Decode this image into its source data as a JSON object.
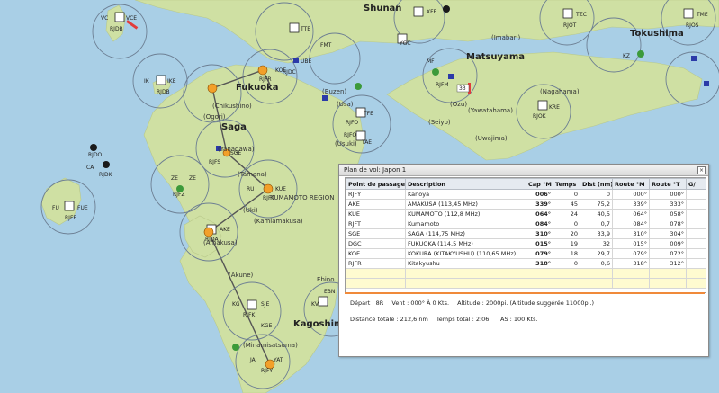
{
  "map": {
    "sea_color": "#a9cfe6",
    "land_color": "#cfe0a3",
    "route_color": "#555555",
    "labels": {
      "shikoku": "Matsuyama",
      "shunan": "Shunan",
      "kagoshima": "Kagoshima",
      "fukuoka": "Fukuoka",
      "saga": "Saga",
      "amakusa": "(Amakusa)",
      "kumamoto_region": "KUMAMOTO REGION",
      "tokushima": "Tokushima",
      "akune": "(Akune)",
      "imabari": "(Imabari)",
      "nagahama": "(Nagahama)",
      "yawatahama": "(Yawatahama)",
      "uwajima": "(Uwajima)",
      "seiyo": "(Seiyo)",
      "usuki": "(Usuki)",
      "yanagawa": "(Yanagawa)",
      "tamana": "(Tamana)",
      "uki": "(Uki)",
      "kamiamakusa": "(Kamiamakusa)",
      "minamisatsuma": "(Minamisatsuma)",
      "chikushino": "(Chikushino)",
      "ogori": "(Ogori)",
      "buzen": "(Buzen)",
      "usa": "(Usa)",
      "ebino": "Ebino",
      "yawatahama2": "(Ozu)",
      "badge": "33"
    },
    "stations": [
      {
        "code": "VCE",
        "sub": "RJDB",
        "extra": "VC"
      },
      {
        "code": "IKE",
        "sub": "RJDB",
        "extra": "IK"
      },
      {
        "code": "FUE",
        "sub": "RJFE",
        "extra": "FU"
      },
      {
        "code": "RJDK",
        "sub": "",
        "extra": "CA"
      },
      {
        "code": "RJDO",
        "sub": "",
        "extra": ""
      },
      {
        "code": "AKE",
        "sub": "RJDA",
        "extra": ""
      },
      {
        "code": "KUE",
        "sub": "RJFT",
        "extra": "RU"
      },
      {
        "code": "TAE",
        "sub": "RJFO",
        "extra": ""
      },
      {
        "code": "TFE",
        "sub": "RJFO",
        "extra": ""
      },
      {
        "code": "KOE",
        "sub": "RJFR",
        "extra": ""
      },
      {
        "code": "FMT",
        "sub": "",
        "extra": ""
      },
      {
        "code": "SGE",
        "sub": "RJFS",
        "extra": ""
      },
      {
        "code": "ZE",
        "sub": "RJFZ",
        "extra": "ZE"
      },
      {
        "code": "SJE",
        "sub": "RJFK",
        "extra": "KG"
      },
      {
        "code": "JA",
        "sub": "RJFY",
        "extra": "YAT"
      },
      {
        "code": "XFE",
        "sub": "",
        "extra": ""
      },
      {
        "code": "UBE",
        "sub": "RJDC",
        "extra": ""
      },
      {
        "code": "YGC",
        "sub": "",
        "extra": ""
      },
      {
        "code": "TTE",
        "sub": "",
        "extra": ""
      },
      {
        "code": "RJFM",
        "sub": "",
        "extra": "MF"
      },
      {
        "code": "KRE",
        "sub": "RJOK",
        "extra": ""
      },
      {
        "code": "TZC",
        "sub": "RJOT",
        "extra": ""
      },
      {
        "code": "TME",
        "sub": "RJOS",
        "extra": ""
      },
      {
        "code": "KZ",
        "sub": "",
        "extra": ""
      },
      {
        "code": "EBN",
        "sub": "",
        "extra": "KV"
      },
      {
        "code": "KGE",
        "sub": "",
        "extra": ""
      }
    ]
  },
  "panel": {
    "title": "Plan de vol: Japon 1",
    "close_glyph": "×",
    "columns": [
      "Point de passage",
      "Description",
      "Cap °M",
      "Temps",
      "Dist (nm)",
      "Route °M",
      "Route °T",
      "G/"
    ],
    "rows": [
      {
        "wp": "RJFY",
        "desc": "Kanoya",
        "cap": "006°",
        "temps": "0",
        "dist": "0",
        "rm": "000°",
        "rt": "000°"
      },
      {
        "wp": "AKE",
        "desc": "AMAKUSA (113,45 MHz)",
        "cap": "339°",
        "temps": "45",
        "dist": "75,2",
        "rm": "339°",
        "rt": "333°"
      },
      {
        "wp": "KUE",
        "desc": "KUMAMOTO (112,8 MHz)",
        "cap": "064°",
        "temps": "24",
        "dist": "40,5",
        "rm": "064°",
        "rt": "058°"
      },
      {
        "wp": "RJFT",
        "desc": "Kumamoto",
        "cap": "084°",
        "temps": "0",
        "dist": "0,7",
        "rm": "084°",
        "rt": "078°"
      },
      {
        "wp": "SGE",
        "desc": "SAGA (114,75 MHz)",
        "cap": "310°",
        "temps": "20",
        "dist": "33,9",
        "rm": "310°",
        "rt": "304°"
      },
      {
        "wp": "DGC",
        "desc": "FUKUOKA (114,5 MHz)",
        "cap": "015°",
        "temps": "19",
        "dist": "32",
        "rm": "015°",
        "rt": "009°"
      },
      {
        "wp": "KOE",
        "desc": "KOKURA (KITAKYUSHU) (110,65 MHz)",
        "cap": "079°",
        "temps": "18",
        "dist": "29,7",
        "rm": "079°",
        "rt": "072°"
      },
      {
        "wp": "RJFR",
        "desc": "Kitakyushu",
        "cap": "318°",
        "temps": "0",
        "dist": "0,6",
        "rm": "318°",
        "rt": "312°"
      }
    ],
    "summary": {
      "depart": "Départ : 8R",
      "vent": "Vent : 000° À 0 Kts.",
      "altitude": "Altitude : 2000pi. (Altitude suggérée 11000pi.)",
      "distance": "Distance totale : 212,6 nm",
      "temps": "Temps total : 2:06",
      "tas": "TAS : 100 Kts."
    },
    "accent_color": "#f08a3a"
  }
}
